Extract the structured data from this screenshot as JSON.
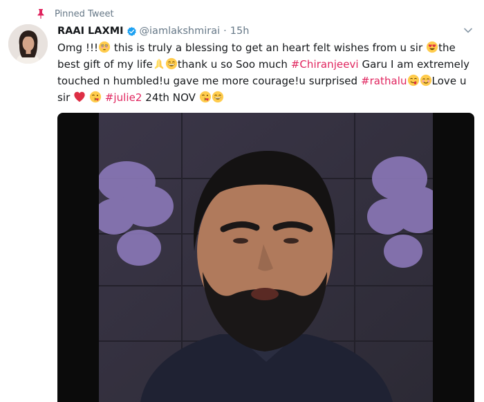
{
  "pinned": {
    "label": "Pinned Tweet",
    "icon": "pin-icon",
    "color": "#e0245e"
  },
  "tweet": {
    "author": {
      "name": "RAAI LAXMI",
      "handle": "@iamlakshmirai",
      "verified": true,
      "avatar_icon": "avatar"
    },
    "separator": "·",
    "time": "15h",
    "text": {
      "seg1": "Omg !!!",
      "seg2": " this is truly a blessing to get an heart felt wishes from u sir ",
      "seg3": "the best gift of my life",
      "seg4": "thank u so Soo much ",
      "hashtag1": "#Chiranjeevi",
      "seg5": " Garu I am extremely touched n humbled!u gave me more courage!u surprised ",
      "hashtag2": "#rathalu",
      "seg6": "Love u sir ",
      "hashtag3": "#julie2",
      "seg7": " 24th NOV "
    },
    "emojis": [
      "flushed-face-icon",
      "heart-eyes-face-icon",
      "folded-hands-icon",
      "grinning-face-icon",
      "face-savoring-icon",
      "smiling-face-icon",
      "red-heart-icon",
      "face-blowing-kiss-icon",
      "face-blowing-kiss-icon",
      "grinning-face-icon"
    ],
    "hashtag_color": "#e0245e",
    "media": {
      "type": "video",
      "icon": "video-thumbnail"
    }
  }
}
